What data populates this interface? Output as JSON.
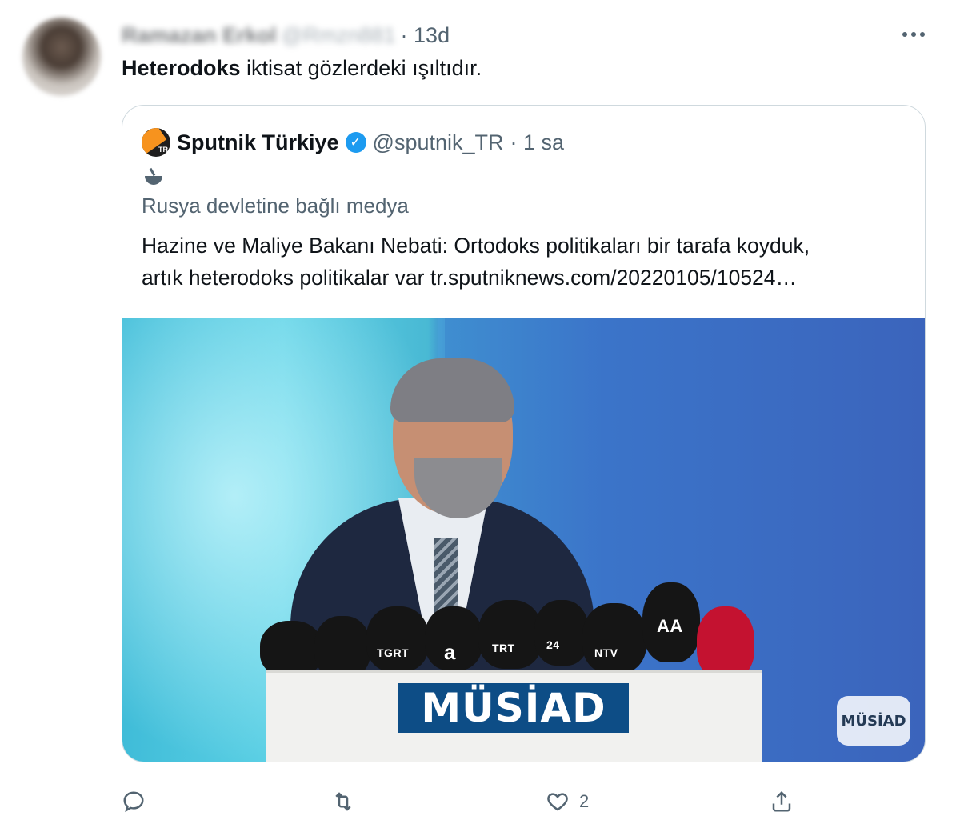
{
  "tweet": {
    "author_name": "Ramazan Erkol",
    "author_handle": "@Rmzn881",
    "time": "· 13d",
    "text_bold": "Heterodoks",
    "text_rest": " iktisat gözlerdeki ışıltıdır."
  },
  "quoted": {
    "name": "Sputnik Türkiye",
    "handle": "@sputnik_TR",
    "time": "· 1 sa",
    "state_label": "Rusya devletine bağlı medya",
    "text_line1": "Hazine ve Maliye Bakanı Nebati: Ortodoks politikaları bir tarafa koyduk,",
    "text_line2": "artık heterodoks politikalar var ",
    "link": "tr.sputniknews.com/20220105/10524…"
  },
  "media": {
    "podium_logo": "MÜSİAD",
    "watermark": "MÜSİAD",
    "mic_labels": [
      "TGRT",
      "a",
      "TRT",
      "24",
      "NTV",
      "AA"
    ]
  },
  "actions": {
    "like_count": "2"
  },
  "colors": {
    "accent": "#1d9bf0",
    "muted": "#536471",
    "border": "#cfd9de"
  }
}
